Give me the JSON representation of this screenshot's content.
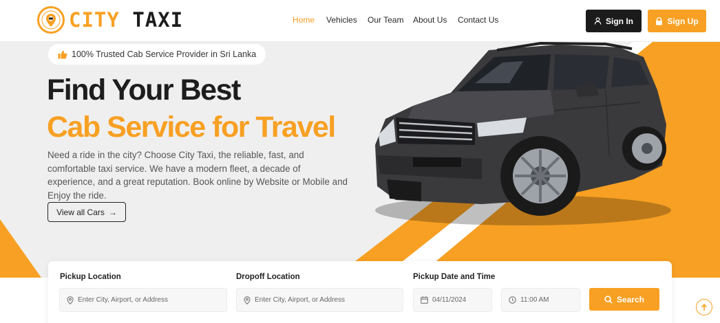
{
  "brand": {
    "name_part1": "CITY",
    "name_part2": "TAXI",
    "accent": "#f8a023",
    "dark": "#1b1b1b"
  },
  "nav": {
    "items": [
      {
        "label": "Home",
        "active": true
      },
      {
        "label": "Vehicles"
      },
      {
        "label": "Our Team"
      },
      {
        "label": "About Us"
      },
      {
        "label": "Contact Us"
      }
    ],
    "signin_label": "Sign In",
    "signup_label": "Sign Up",
    "signin_icon": "user-icon",
    "signup_icon": "lock-icon"
  },
  "hero": {
    "badge_text": "100% Trusted Cab Service Provider in Sri Lanka",
    "badge_icon": "thumbs-up-icon",
    "title_line1": "Find Your Best",
    "title_line2": "Cab Service for Travel",
    "description": "Need a ride in the city? Choose City Taxi, the reliable, fast, and comfortable taxi service. We have a modern fleet, a decade of experience, and a great reputation. Book online by Website or Mobile and Enjoy the ride.",
    "cta_label": "View all Cars",
    "cta_arrow": "→",
    "image": "dark-grey-suv-car"
  },
  "search_form": {
    "pickup": {
      "label": "Pickup Location",
      "placeholder": "Enter City, Airport, or Address",
      "icon": "map-pin-icon"
    },
    "dropoff": {
      "label": "Dropoff Location",
      "placeholder": "Enter City, Airport, or Address",
      "icon": "map-pin-icon"
    },
    "datetime": {
      "label": "Pickup Date and Time",
      "date": "04/11/2024",
      "time": "11:00 AM",
      "date_icon": "calendar-icon",
      "time_icon": "clock-icon"
    },
    "search_label": "Search",
    "search_icon": "search-icon"
  },
  "scroll_top_icon": "arrow-up-icon"
}
